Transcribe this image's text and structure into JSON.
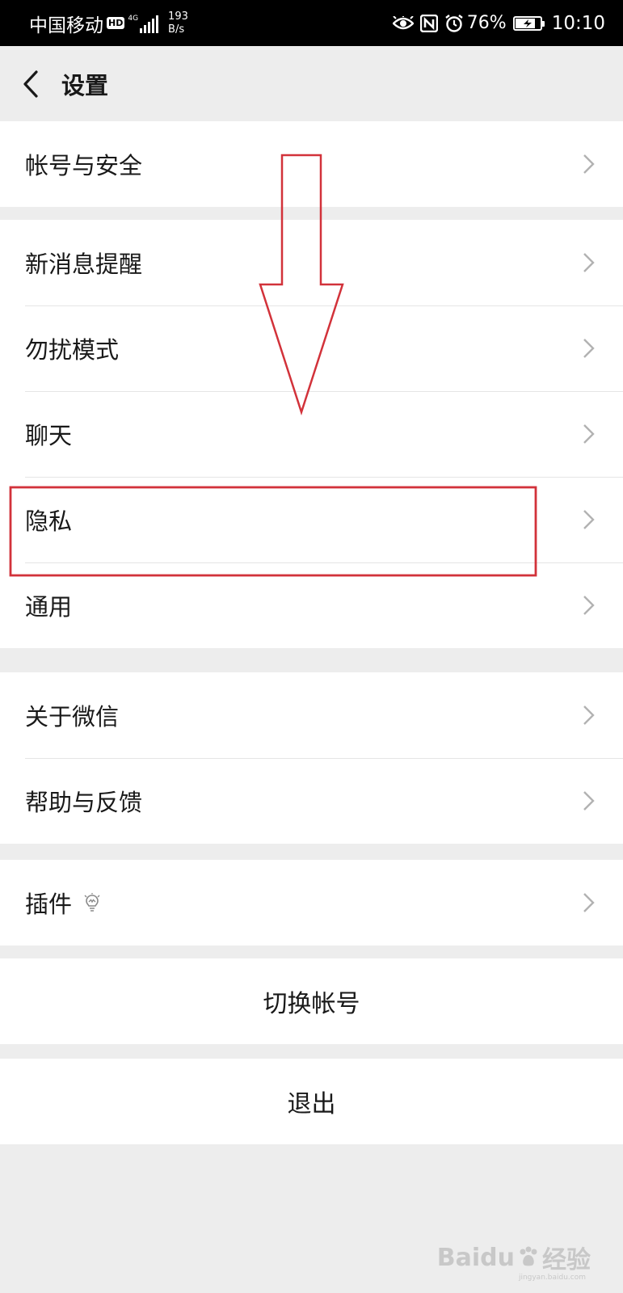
{
  "status_bar": {
    "carrier": "中国移动",
    "hd_badge": "HD",
    "network_type": "4G",
    "speed_value": "193",
    "speed_unit": "B/s",
    "battery_percent": "76%",
    "time": "10:10",
    "icons": [
      "eye-comfort-icon",
      "nfc-icon",
      "alarm-icon",
      "battery-charging-icon"
    ]
  },
  "header": {
    "title": "设置",
    "back_icon": "chevron-left-icon"
  },
  "groups": [
    {
      "items": [
        {
          "label": "帐号与安全"
        }
      ]
    },
    {
      "items": [
        {
          "label": "新消息提醒"
        },
        {
          "label": "勿扰模式"
        },
        {
          "label": "聊天"
        },
        {
          "label": "隐私"
        },
        {
          "label": "通用"
        }
      ]
    },
    {
      "items": [
        {
          "label": "关于微信"
        },
        {
          "label": "帮助与反馈"
        }
      ]
    },
    {
      "items": [
        {
          "label": "插件",
          "icon": "lightbulb-icon"
        }
      ]
    }
  ],
  "actions": {
    "switch_account": "切换帐号",
    "logout": "退出"
  },
  "annotations": {
    "arrow_color": "#d2323a",
    "highlight_color": "#d2323a",
    "highlighted_item": "隐私"
  },
  "watermark": {
    "brand": "Baidu",
    "brand_cn": "经验",
    "url": "jingyan.baidu.com"
  },
  "colors": {
    "background": "#ededed",
    "status_bar": "#000000",
    "row_background": "#ffffff",
    "divider": "#e5e5e5",
    "chevron": "#b2b2b2",
    "annotation_red": "#d2323a"
  }
}
